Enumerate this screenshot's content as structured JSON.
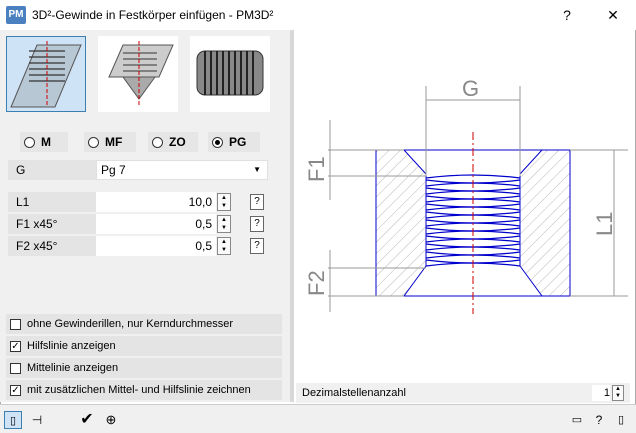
{
  "window": {
    "title": "3D²-Gewinde in Festkörper einfügen   -   PM3D²",
    "app_icon": "PM",
    "help_button": "?",
    "close_button": "✕"
  },
  "thread_types": [
    "M",
    "MF",
    "ZO",
    "PG"
  ],
  "selected_thread_type": "PG",
  "fields": {
    "g_label": "G",
    "g_value": "Pg 7",
    "l1_label": "L1",
    "l1_value": "10,0",
    "f1_label": "F1  x45°",
    "f1_value": "0,5",
    "f2_label": "F2  x45°",
    "f2_value": "0,5",
    "help_glyph": "?"
  },
  "checkboxes": [
    {
      "label": "ohne Gewinderillen, nur Kerndurchmesser",
      "checked": false
    },
    {
      "label": "Hilfslinie anzeigen",
      "checked": true
    },
    {
      "label": "Mittelinie anzeigen",
      "checked": false
    },
    {
      "label": "mit zusätzlichen Mittel- und Hilfslinie zeichnen",
      "checked": true
    }
  ],
  "drawing_labels": {
    "g": "G",
    "f1": "F1",
    "f2": "F2",
    "l1": "L1"
  },
  "decimal": {
    "label": "Dezimalstellenanzahl",
    "value": "1"
  },
  "bottom": {
    "check_glyph": "✔",
    "minimize_glyph": "▭",
    "help_glyph": "?",
    "dock_glyph": "▯"
  },
  "colors": {
    "accent": "#3c7fb1",
    "drawing_blue": "#0000cc",
    "center_red": "#cc0000"
  }
}
